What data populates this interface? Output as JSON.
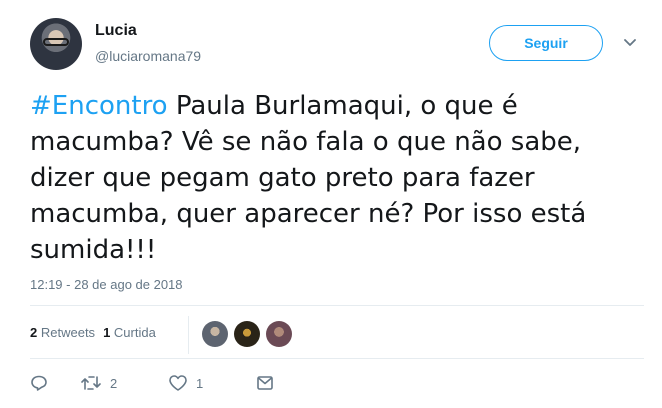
{
  "author": {
    "name": "Lucia",
    "handle": "@luciaromana79"
  },
  "follow_button": {
    "label": "Seguir"
  },
  "tweet": {
    "hashtag": "#Encontro",
    "text": " Paula Burlamaqui, o que é\nmacumba? Vê se não fala o que não sabe,\ndizer que pegam gato preto para fazer\nmacumba, quer aparecer né? Por isso está\nsumida!!!",
    "timestamp": "12:19 - 28 de ago de 2018"
  },
  "stats": {
    "retweets_count": "2",
    "retweets_label": "Retweets",
    "likes_count": "1",
    "likes_label": "Curtida"
  },
  "actions": {
    "retweet_count": "2",
    "like_count": "1"
  },
  "colors": {
    "accent": "#1da1f2",
    "muted": "#657786",
    "text": "#14171a"
  },
  "icons": [
    "avatar",
    "chevron-down-icon",
    "reply-icon",
    "retweet-icon",
    "heart-icon",
    "message-icon"
  ]
}
